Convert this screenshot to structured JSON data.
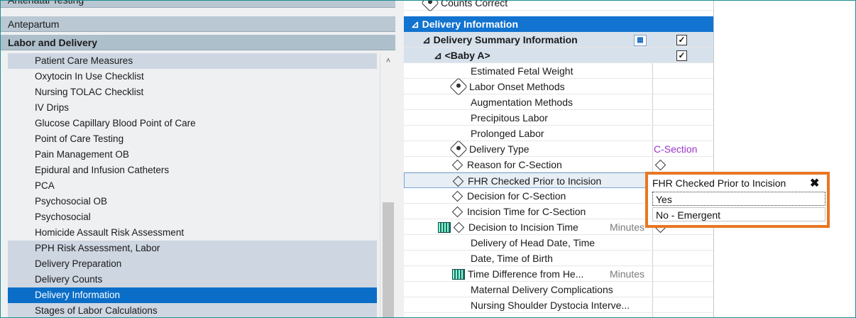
{
  "navigator": {
    "top_partial": "Antenatal Testing",
    "categories": [
      "Antepartum",
      "Labor and Delivery"
    ],
    "items": [
      {
        "label": "Patient Care Measures",
        "shaded": true
      },
      {
        "label": "Oxytocin In Use Checklist",
        "shaded": false
      },
      {
        "label": "Nursing TOLAC Checklist",
        "shaded": false
      },
      {
        "label": "IV Drips",
        "shaded": false
      },
      {
        "label": "Glucose Capillary Blood Point of Care",
        "shaded": false
      },
      {
        "label": "Point of Care Testing",
        "shaded": false
      },
      {
        "label": "Pain Management OB",
        "shaded": false
      },
      {
        "label": "Epidural and Infusion Catheters",
        "shaded": false
      },
      {
        "label": "PCA",
        "shaded": false
      },
      {
        "label": "Psychosocial OB",
        "shaded": false
      },
      {
        "label": "Psychosocial",
        "shaded": false
      },
      {
        "label": "Homicide Assault Risk Assessment",
        "shaded": false
      },
      {
        "label": "PPH Risk Assessment, Labor",
        "shaded": true
      },
      {
        "label": "Delivery Preparation",
        "shaded": true
      },
      {
        "label": "Delivery Counts",
        "shaded": true
      },
      {
        "label": "Delivery Information",
        "selected": true
      },
      {
        "label": "Stages of Labor Calculations",
        "shaded": true
      }
    ]
  },
  "tree": {
    "counts_correct": "Counts Correct",
    "section": "Delivery Information",
    "summary": "Delivery Summary Information",
    "baby": "<Baby A>",
    "checkmark": "✓",
    "rows": [
      "Estimated Fetal Weight",
      "Labor Onset Methods",
      "Augmentation Methods",
      "Precipitous Labor",
      "Prolonged Labor",
      "Delivery Type",
      "Reason for C-Section",
      "FHR Checked Prior to Incision",
      "Decision for C-Section",
      "Incision Time for C-Section",
      "Decision to Incision Time",
      "Delivery of Head Date, Time",
      "Date, Time of Birth",
      "Time Difference from He...",
      "Maternal Delivery Complications",
      "Nursing Shoulder Dystocia Interve..."
    ],
    "delivery_type_value": "C-Section",
    "unit_minutes": "Minutes"
  },
  "popup": {
    "title": "FHR Checked Prior to Incision",
    "close": "✖",
    "options": [
      "Yes",
      "No - Emergent"
    ]
  },
  "colors": {
    "accent": "#1273d0",
    "popup_border": "#e87722",
    "value": "#9b34c9"
  }
}
